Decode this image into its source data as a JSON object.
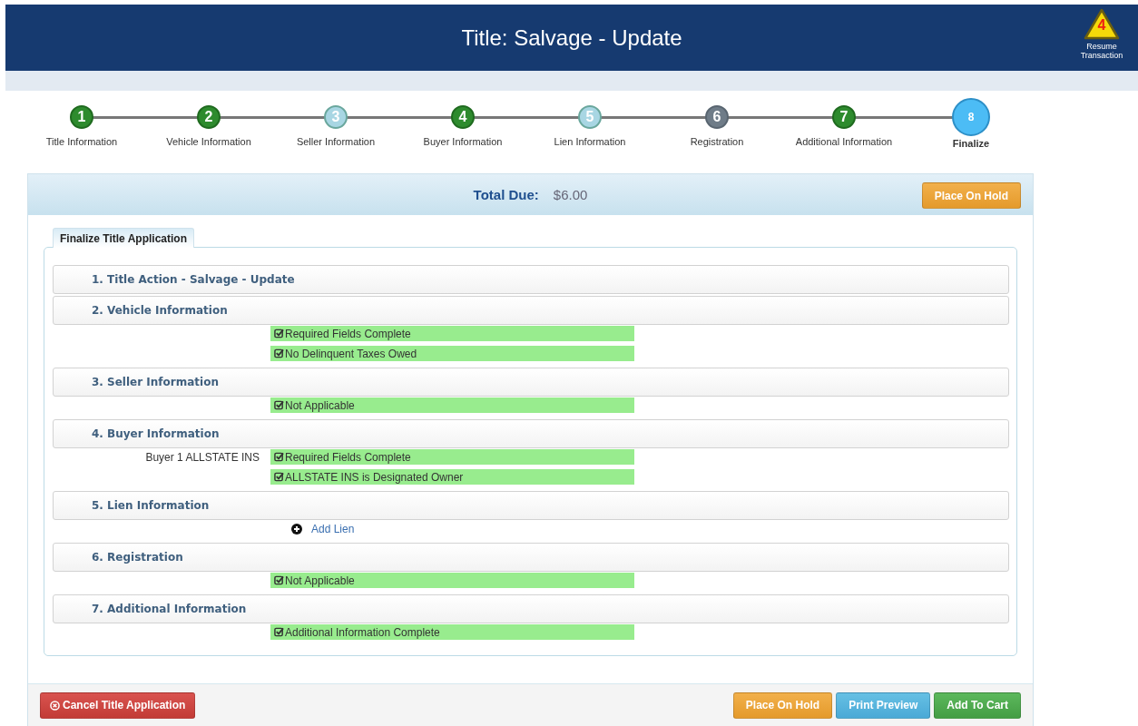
{
  "header": {
    "title": "Title: Salvage - Update",
    "resume": {
      "count": "4",
      "label": "Resume Transaction"
    }
  },
  "steps": [
    {
      "number": "1",
      "label": "Title Information",
      "kind": "complete"
    },
    {
      "number": "2",
      "label": "Vehicle Information",
      "kind": "complete"
    },
    {
      "number": "3",
      "label": "Seller Information",
      "kind": "incomplete"
    },
    {
      "number": "4",
      "label": "Buyer Information",
      "kind": "complete"
    },
    {
      "number": "5",
      "label": "Lien Information",
      "kind": "incomplete"
    },
    {
      "number": "6",
      "label": "Registration",
      "kind": "disabled"
    },
    {
      "number": "7",
      "label": "Additional Information",
      "kind": "complete"
    },
    {
      "number": "8",
      "label": "Finalize",
      "kind": "current"
    }
  ],
  "total": {
    "label": "Total Due:",
    "amount": "$6.00"
  },
  "place_on_hold_top": "Place On Hold",
  "tab": "Finalize Title Application",
  "sections": [
    {
      "title": "1. Title Action - Salvage - Update"
    },
    {
      "title": "2. Vehicle Information",
      "items": [
        {
          "kind": "check",
          "text": "Required Fields Complete"
        },
        {
          "kind": "check",
          "text": "No Delinquent Taxes Owed"
        }
      ]
    },
    {
      "title": "3. Seller Information",
      "items": [
        {
          "kind": "check",
          "text": "Not Applicable"
        }
      ]
    },
    {
      "title": "4. Buyer Information",
      "items": [
        {
          "kind": "check",
          "label": "Buyer 1 ALLSTATE INS",
          "text": "Required Fields Complete"
        },
        {
          "kind": "check",
          "text": "ALLSTATE INS is Designated Owner"
        }
      ]
    },
    {
      "title": "5. Lien Information",
      "items": [
        {
          "kind": "link",
          "text": "Add Lien"
        }
      ]
    },
    {
      "title": "6. Registration",
      "items": [
        {
          "kind": "check",
          "text": "Not Applicable"
        }
      ]
    },
    {
      "title": "7. Additional Information",
      "items": [
        {
          "kind": "check",
          "text": "Additional Information Complete"
        }
      ]
    }
  ],
  "footer": {
    "cancel": "Cancel Title Application",
    "buttons": [
      {
        "kind": "hold",
        "label": "Place On Hold"
      },
      {
        "kind": "preview",
        "label": "Print Preview"
      },
      {
        "kind": "cart",
        "label": "Add To Cart"
      }
    ]
  }
}
